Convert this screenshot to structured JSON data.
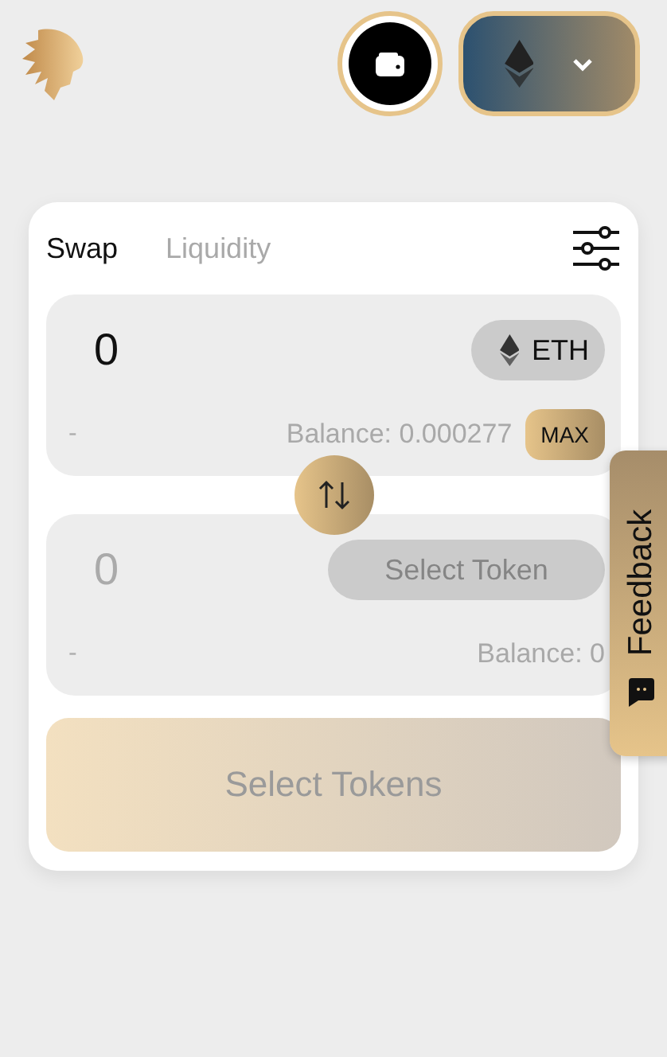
{
  "tabs": [
    {
      "label": "Swap",
      "selected": true
    },
    {
      "label": "Liquidity",
      "selected": false
    }
  ],
  "from": {
    "value": "0",
    "note": "-",
    "token": "ETH",
    "balance": "Balance: 0.000277",
    "max": "MAX"
  },
  "to": {
    "placeholder": "0",
    "note": "-",
    "token": "Select Token",
    "balance": "Balance: 0"
  },
  "action": {
    "label": "Select Tokens",
    "disabled": true
  },
  "feedback": {
    "label": "Feedback"
  }
}
